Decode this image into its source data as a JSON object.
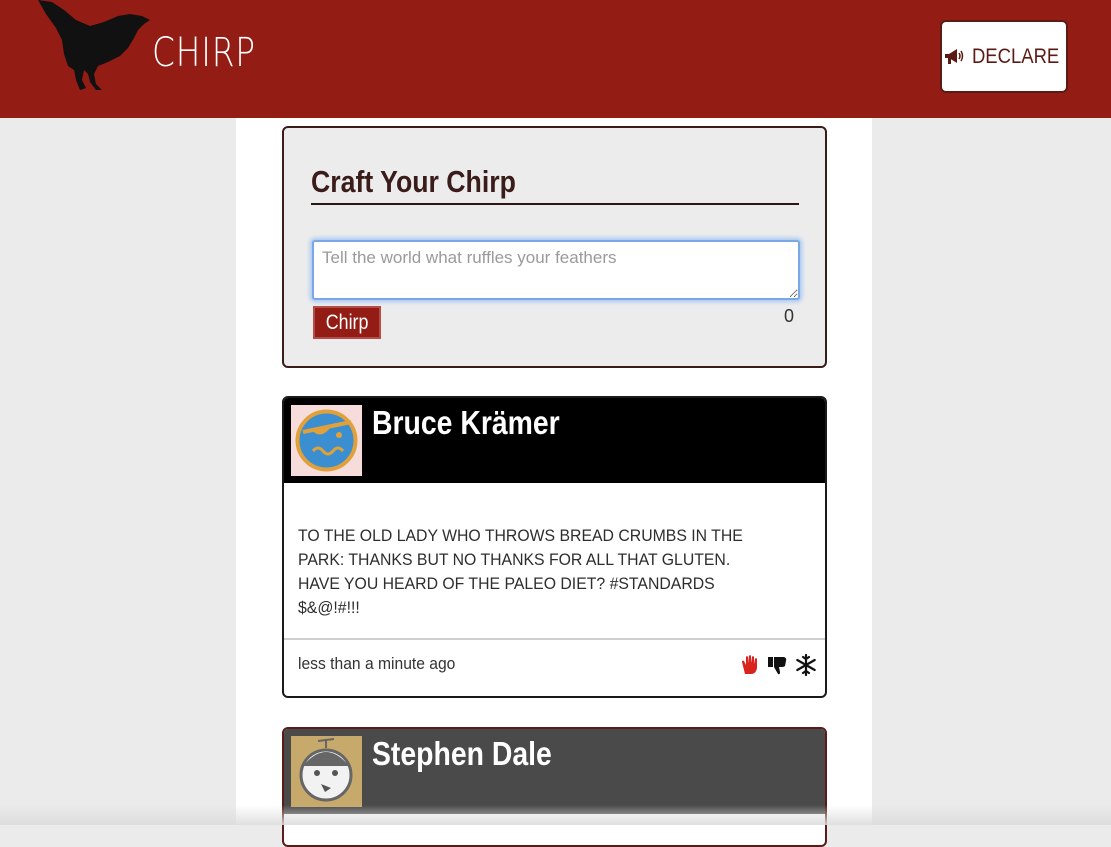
{
  "app": {
    "title": "CHIRP",
    "brand_color": "#931c15",
    "logo_icon": "bird-silhouette-icon"
  },
  "header": {
    "declare_label": "DECLARE",
    "declare_icon": "megaphone-icon"
  },
  "composer": {
    "title": "Craft Your Chirp",
    "placeholder": "Tell the world what ruffles your feathers",
    "value": "",
    "submit_label": "Chirp",
    "char_count": "0"
  },
  "feed": {
    "posts": [
      {
        "author": "Bruce Krämer",
        "avatar_icon": "eyepatch-face-avatar",
        "header_color": "#000000",
        "body": "TO THE OLD LADY WHO THROWS BREAD CRUMBS IN THE PARK: THANKS BUT NO THANKS FOR ALL THAT GLUTEN. HAVE YOU HEARD OF THE PALEO DIET? #STANDARDS $&@!#!!!",
        "timestamp": "less than a minute ago",
        "actions": [
          "hand-stop-icon",
          "thumbs-down-icon",
          "snowflake-icon"
        ]
      },
      {
        "author": "Stephen Dale",
        "avatar_icon": "propeller-cap-face-avatar",
        "header_color": "#4a4a4a"
      }
    ]
  }
}
